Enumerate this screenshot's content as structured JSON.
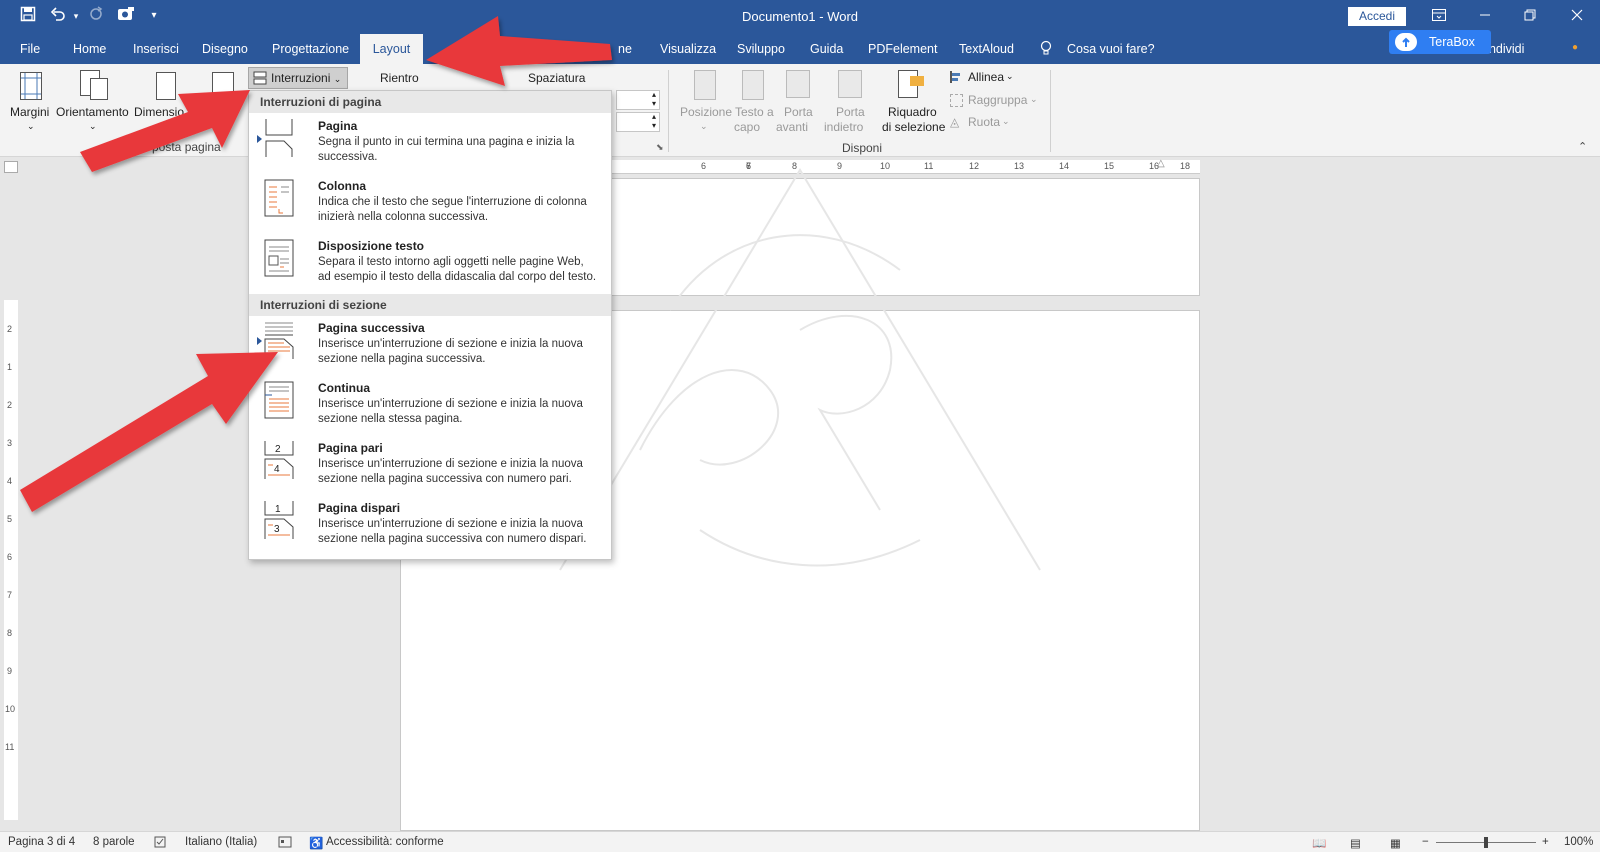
{
  "titlebar": {
    "doc_title": "Documento1  -  Word",
    "accedi": "Accedi",
    "icons": [
      "save-icon",
      "undo-icon",
      "redo-icon",
      "touch-mode-icon",
      "customize-qat-icon"
    ],
    "win_buttons": [
      "ribbon-display-icon",
      "minimize-icon",
      "restore-icon",
      "close-icon"
    ]
  },
  "tabs": {
    "file": "File",
    "home": "Home",
    "inserisci": "Inserisci",
    "disegno": "Disegno",
    "progettazione": "Progettazione",
    "layout": "Layout",
    "partial_ne": "ne",
    "visualizza": "Visualizza",
    "sviluppo": "Sviluppo",
    "guida": "Guida",
    "pdfelement": "PDFelement",
    "textaloud": "TextAloud",
    "tell_me": "Cosa vuoi fare?",
    "condividi": "ondividi",
    "terabox": "TeraBox"
  },
  "ribbon": {
    "margini": "Margini",
    "orientamento": "Orientamento",
    "dimensioni": "Dimensio",
    "interruzioni": "Interruzioni",
    "rientro": "Rientro",
    "spaziatura": "Spaziatura",
    "imposta_pagina_label": "posta pagina",
    "posizione": [
      "Posizione",
      ""
    ],
    "testo_a_capo": [
      "Testo a",
      "capo"
    ],
    "porta_avanti": [
      "Porta",
      "avanti"
    ],
    "porta_indietro": [
      "Porta",
      "indietro"
    ],
    "riquadro": [
      "Riquadro",
      "di selezione"
    ],
    "allinea": "Allinea",
    "raggruppa": "Raggruppa",
    "ruota": "Ruota",
    "disponi_label": "Disponi"
  },
  "menu": {
    "header_pagina": "Interruzioni di pagina",
    "header_sezione": "Interruzioni di sezione",
    "items": [
      {
        "title": "Pagina",
        "desc": [
          "Segna il punto in cui termina una pagina e inizia la",
          "successiva."
        ]
      },
      {
        "title": "Colonna",
        "desc": [
          "Indica che il testo che segue l'interruzione di colonna",
          "inizierà nella colonna successiva."
        ]
      },
      {
        "title": "Disposizione testo",
        "desc": [
          "Separa il testo intorno agli oggetti nelle pagine Web,",
          "ad esempio il testo della didascalia dal corpo del testo."
        ]
      },
      {
        "title": "Pagina successiva",
        "desc": [
          "Inserisce un'interruzione di sezione e inizia la nuova",
          "sezione nella pagina successiva."
        ]
      },
      {
        "title": "Continua",
        "desc": [
          "Inserisce un'interruzione di sezione e inizia la nuova",
          "sezione nella stessa pagina."
        ]
      },
      {
        "title": "Pagina pari",
        "desc": [
          "Inserisce un'interruzione di sezione e inizia la nuova",
          "sezione nella pagina successiva con numero pari."
        ]
      },
      {
        "title": "Pagina dispari",
        "desc": [
          "Inserisce un'interruzione di sezione e inizia la nuova",
          "sezione nella pagina successiva con numero dispari."
        ]
      }
    ]
  },
  "ruler": {
    "h_ticks": [
      "6",
      "7",
      "8",
      "9",
      "10",
      "11",
      "12",
      "13",
      "14",
      "15",
      "16",
      "18"
    ],
    "v_ticks": [
      "2",
      "1",
      "1",
      "2",
      "3",
      "4",
      "5",
      "6",
      "7",
      "8",
      "9",
      "10",
      "11"
    ]
  },
  "statusbar": {
    "pagina": "Pagina 3 di 4",
    "parole": "8 parole",
    "lingua": "Italiano (Italia)",
    "accessibilita": "Accessibilità: conforme",
    "zoom": "100%"
  },
  "colors": {
    "titlebar": "#2b579a",
    "terabox": "#2f7ef2",
    "arrow": "#e8373b"
  }
}
